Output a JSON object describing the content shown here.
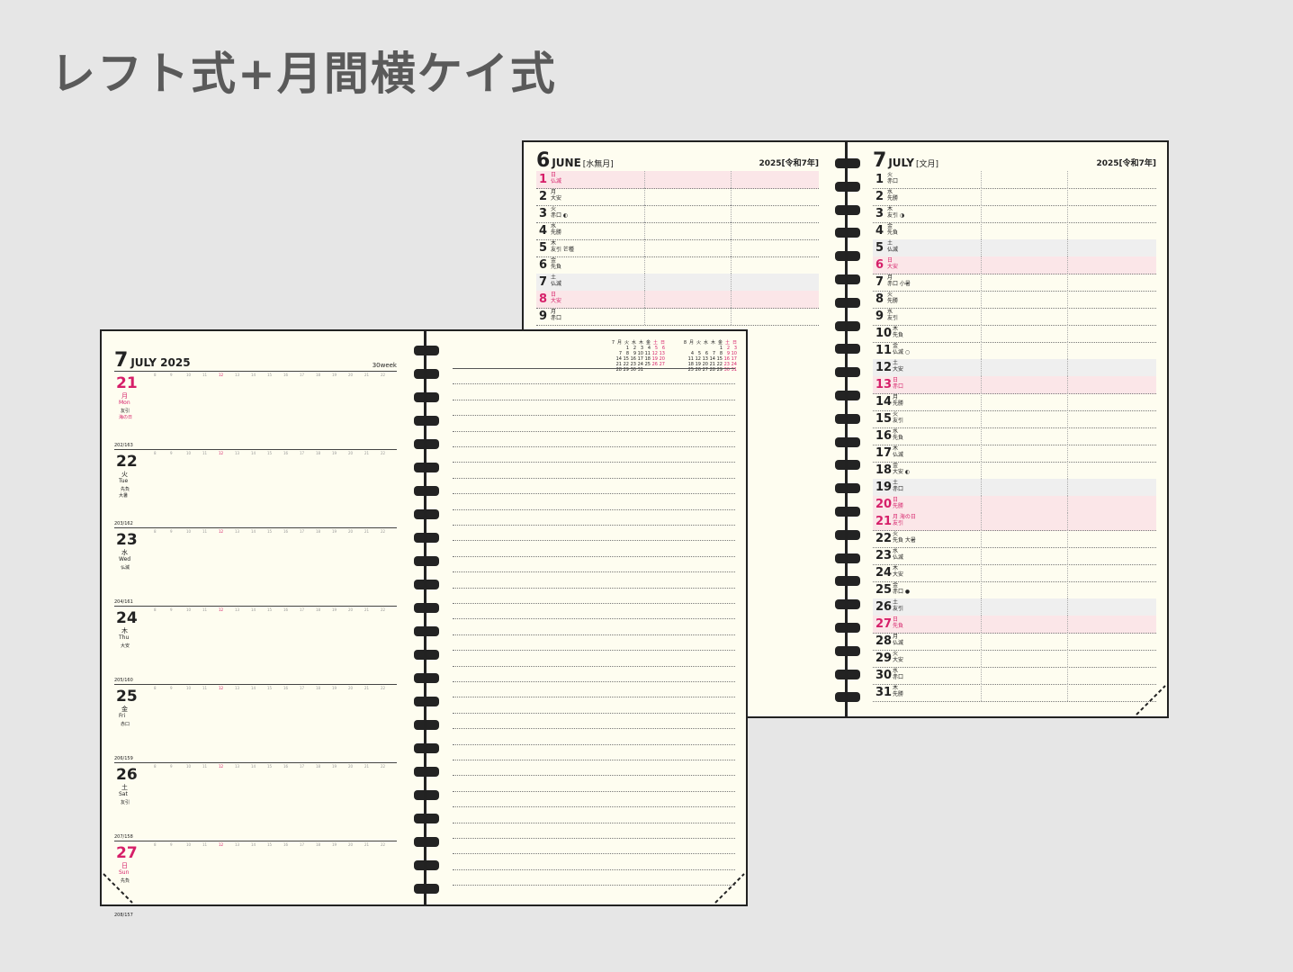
{
  "title": "レフト式+月間横ケイ式",
  "colors": {
    "accent": "#d61f69",
    "paper": "#fefdf0",
    "background": "#e6e6e6"
  },
  "monthly_left": {
    "month_num": "6",
    "month_en": "JUNE",
    "month_jp": "[水無月]",
    "year": "2025[令和7年]",
    "days": [
      {
        "d": "1",
        "w": "日",
        "r": "仏滅",
        "type": "sun"
      },
      {
        "d": "2",
        "w": "月",
        "r": "大安",
        "type": ""
      },
      {
        "d": "3",
        "w": "火",
        "r": "赤口 ◐",
        "type": ""
      },
      {
        "d": "4",
        "w": "水",
        "r": "先勝",
        "type": ""
      },
      {
        "d": "5",
        "w": "木",
        "r": "友引 芒種",
        "type": ""
      },
      {
        "d": "6",
        "w": "金",
        "r": "先負",
        "type": ""
      },
      {
        "d": "7",
        "w": "土",
        "r": "仏滅",
        "type": "sat"
      },
      {
        "d": "8",
        "w": "日",
        "r": "大安",
        "type": "sun"
      },
      {
        "d": "9",
        "w": "月",
        "r": "赤口",
        "type": ""
      }
    ]
  },
  "monthly_right": {
    "month_num": "7",
    "month_en": "JULY",
    "month_jp": "[文月]",
    "year": "2025[令和7年]",
    "days": [
      {
        "d": "1",
        "w": "火",
        "r": "赤口",
        "type": ""
      },
      {
        "d": "2",
        "w": "水",
        "r": "先勝",
        "type": ""
      },
      {
        "d": "3",
        "w": "木",
        "r": "友引 ◑",
        "type": ""
      },
      {
        "d": "4",
        "w": "金",
        "r": "先負",
        "type": ""
      },
      {
        "d": "5",
        "w": "土",
        "r": "仏滅",
        "type": "sat"
      },
      {
        "d": "6",
        "w": "日",
        "r": "大安",
        "type": "sun"
      },
      {
        "d": "7",
        "w": "月",
        "r": "赤口 小暑",
        "type": ""
      },
      {
        "d": "8",
        "w": "火",
        "r": "先勝",
        "type": ""
      },
      {
        "d": "9",
        "w": "水",
        "r": "友引",
        "type": ""
      },
      {
        "d": "10",
        "w": "木",
        "r": "先負",
        "type": ""
      },
      {
        "d": "11",
        "w": "金",
        "r": "仏滅 ○",
        "type": ""
      },
      {
        "d": "12",
        "w": "土",
        "r": "大安",
        "type": "sat"
      },
      {
        "d": "13",
        "w": "日",
        "r": "赤口",
        "type": "sun"
      },
      {
        "d": "14",
        "w": "月",
        "r": "先勝",
        "type": ""
      },
      {
        "d": "15",
        "w": "火",
        "r": "友引",
        "type": ""
      },
      {
        "d": "16",
        "w": "水",
        "r": "先負",
        "type": ""
      },
      {
        "d": "17",
        "w": "木",
        "r": "仏滅",
        "type": ""
      },
      {
        "d": "18",
        "w": "金",
        "r": "大安 ◐",
        "type": ""
      },
      {
        "d": "19",
        "w": "土",
        "r": "赤口",
        "type": "sat"
      },
      {
        "d": "20",
        "w": "日",
        "r": "先勝",
        "type": "sun"
      },
      {
        "d": "21",
        "w": "月 海の日",
        "r": "友引",
        "type": "sun"
      },
      {
        "d": "22",
        "w": "火",
        "r": "先負 大暑",
        "type": ""
      },
      {
        "d": "23",
        "w": "水",
        "r": "仏滅",
        "type": ""
      },
      {
        "d": "24",
        "w": "木",
        "r": "大安",
        "type": ""
      },
      {
        "d": "25",
        "w": "金",
        "r": "赤口 ●",
        "type": ""
      },
      {
        "d": "26",
        "w": "土",
        "r": "友引",
        "type": "sat"
      },
      {
        "d": "27",
        "w": "日",
        "r": "先負",
        "type": "sun"
      },
      {
        "d": "28",
        "w": "月",
        "r": "仏滅",
        "type": ""
      },
      {
        "d": "29",
        "w": "火",
        "r": "大安",
        "type": ""
      },
      {
        "d": "30",
        "w": "水",
        "r": "赤口",
        "type": ""
      },
      {
        "d": "31",
        "w": "木",
        "r": "先勝",
        "type": ""
      }
    ]
  },
  "weekly": {
    "month_num": "7",
    "month_en": "JULY 2025",
    "week": "30week",
    "times": [
      "8",
      "9",
      "10",
      "11",
      "12",
      "13",
      "14",
      "15",
      "16",
      "17",
      "18",
      "19",
      "20",
      "21",
      "22"
    ],
    "days": [
      {
        "d": "21",
        "jp": "月",
        "en": "Mon",
        "rk": "友引",
        "rk2": "海の日",
        "bt": "202/163",
        "type": "monday"
      },
      {
        "d": "22",
        "jp": "火",
        "en": "Tue",
        "rk": "先負",
        "rk2": "大暑",
        "bt": "203/162",
        "type": ""
      },
      {
        "d": "23",
        "jp": "水",
        "en": "Wed",
        "rk": "仏滅",
        "rk2": "",
        "bt": "204/161",
        "type": ""
      },
      {
        "d": "24",
        "jp": "木",
        "en": "Thu",
        "rk": "大安",
        "rk2": "",
        "bt": "205/160",
        "type": ""
      },
      {
        "d": "25",
        "jp": "金",
        "en": "Fri",
        "rk": "赤口",
        "rk2": "",
        "bt": "206/159",
        "type": ""
      },
      {
        "d": "26",
        "jp": "土",
        "en": "Sat",
        "rk": "友引",
        "rk2": "",
        "bt": "207/158",
        "type": ""
      },
      {
        "d": "27",
        "jp": "日",
        "en": "Sun",
        "rk": "先負",
        "rk2": "",
        "bt": "208/157",
        "type": "sunday"
      }
    ],
    "mini_cal_7": {
      "label": "7",
      "rows": [
        [
          "月",
          "火",
          "水",
          "木",
          "金",
          "土",
          "日"
        ],
        [
          "",
          "1",
          "2",
          "3",
          "4",
          "5",
          "6"
        ],
        [
          "7",
          "8",
          "9",
          "10",
          "11",
          "12",
          "13"
        ],
        [
          "14",
          "15",
          "16",
          "17",
          "18",
          "19",
          "20"
        ],
        [
          "21",
          "22",
          "23",
          "24",
          "25",
          "26",
          "27"
        ],
        [
          "28",
          "29",
          "30",
          "31",
          "",
          "",
          ""
        ]
      ]
    },
    "mini_cal_8": {
      "label": "8",
      "rows": [
        [
          "月",
          "火",
          "水",
          "木",
          "金",
          "土",
          "日"
        ],
        [
          "",
          "",
          "",
          "",
          "1",
          "2",
          "3"
        ],
        [
          "4",
          "5",
          "6",
          "7",
          "8",
          "9",
          "10"
        ],
        [
          "11",
          "12",
          "13",
          "14",
          "15",
          "16",
          "17"
        ],
        [
          "18",
          "19",
          "20",
          "21",
          "22",
          "23",
          "24"
        ],
        [
          "25",
          "26",
          "27",
          "28",
          "29",
          "30",
          "31"
        ]
      ]
    }
  }
}
